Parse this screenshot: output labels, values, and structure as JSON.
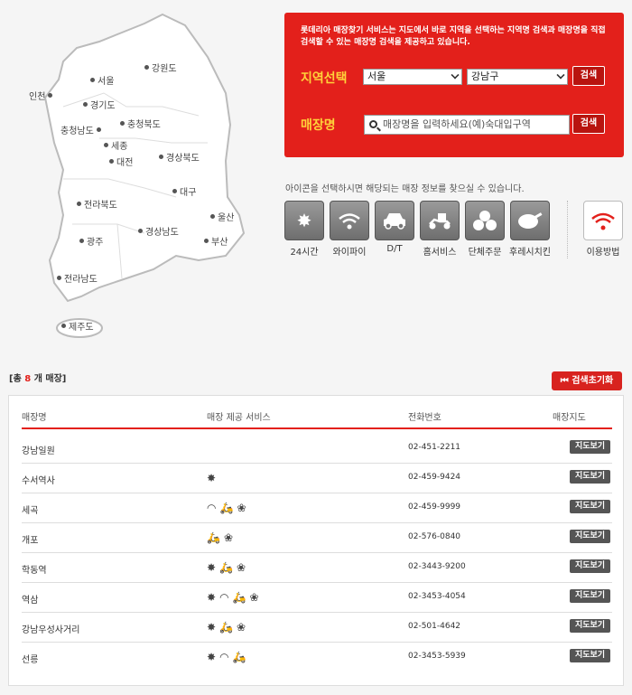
{
  "map": {
    "regions": [
      {
        "name": "강원도"
      },
      {
        "name": "서울"
      },
      {
        "name": "인천"
      },
      {
        "name": "경기도"
      },
      {
        "name": "충청북도"
      },
      {
        "name": "충청남도"
      },
      {
        "name": "세종"
      },
      {
        "name": "대전"
      },
      {
        "name": "경상북도"
      },
      {
        "name": "대구"
      },
      {
        "name": "전라북도"
      },
      {
        "name": "울산"
      },
      {
        "name": "경상남도"
      },
      {
        "name": "부산"
      },
      {
        "name": "광주"
      },
      {
        "name": "전라남도"
      },
      {
        "name": "제주도"
      }
    ]
  },
  "search": {
    "description": "롯데리아 매장찾기 서비스는 지도에서 바로 지역을 선택하는 지역명 검색과 매장명을 직접 검색할 수 있는 매장명 검색을 제공하고 있습니다.",
    "region_label": "지역선택",
    "city_value": "서울",
    "district_value": "강남구",
    "search_button": "검색",
    "store_label": "매장명",
    "store_placeholder": "매장명을 입력하세요(예)숙대입구역",
    "store_button": "검색"
  },
  "services": {
    "hint": "아이콘을 선택하시면 해당되는 매장 정보를 찾으실 수 있습니다.",
    "items": [
      {
        "label": "24시간",
        "icon": "star-burst-icon"
      },
      {
        "label": "와이파이",
        "icon": "wifi-icon"
      },
      {
        "label": "D/T",
        "icon": "car-icon"
      },
      {
        "label": "홈서비스",
        "icon": "scooter-icon"
      },
      {
        "label": "단체주문",
        "icon": "group-icon"
      },
      {
        "label": "후레시치킨",
        "icon": "chicken-icon"
      }
    ],
    "guide_label": "이용방법"
  },
  "results": {
    "count_prefix": "[총",
    "count": "8",
    "count_suffix": "개 매장]",
    "reset_button": "검색초기화",
    "headers": {
      "name": "매장명",
      "services": "매장 제공 서비스",
      "phone": "전화번호",
      "map": "매장지도"
    },
    "map_button": "지도보기",
    "rows": [
      {
        "name": "강남일원",
        "phone": "02-451-2211"
      },
      {
        "name": "수서역사",
        "phone": "02-459-9424"
      },
      {
        "name": "세곡",
        "phone": "02-459-9999"
      },
      {
        "name": "개포",
        "phone": "02-576-0840"
      },
      {
        "name": "학동역",
        "phone": "02-3443-9200"
      },
      {
        "name": "역삼",
        "phone": "02-3453-4054"
      },
      {
        "name": "강남우성사거리",
        "phone": "02-501-4642"
      },
      {
        "name": "선릉",
        "phone": "02-3453-5939"
      }
    ]
  },
  "colors": {
    "accent": "#e3201b",
    "highlight": "#ffd23a"
  }
}
